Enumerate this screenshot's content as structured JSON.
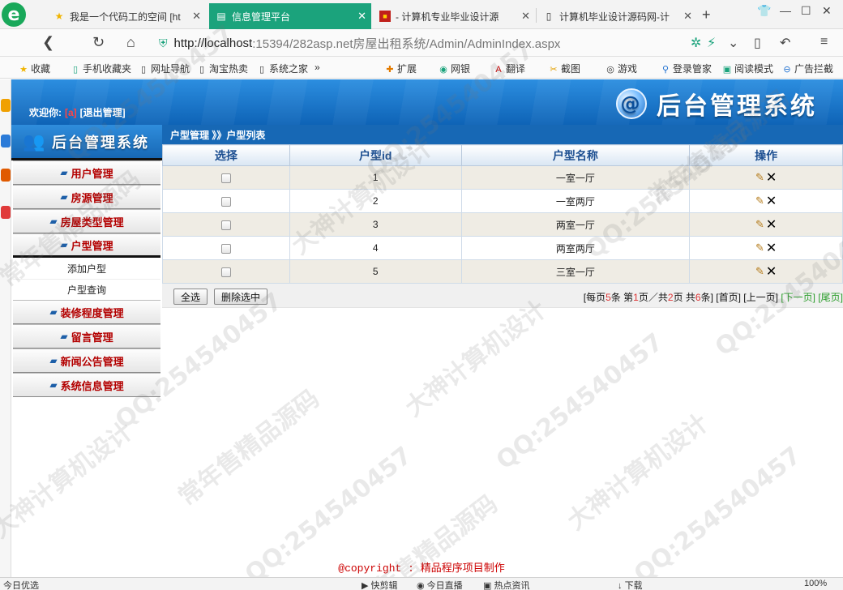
{
  "browser": {
    "tabs": [
      {
        "label": "我是一个代码工的空间 [ht",
        "icon": "star-icon"
      },
      {
        "label": "信息管理平台",
        "icon": "page-icon",
        "active": true
      },
      {
        "label": "- 计算机专业毕业设计源",
        "icon": "site-icon"
      },
      {
        "label": "计算机毕业设计源码网-计",
        "icon": "page-icon"
      }
    ],
    "url_host": "http://localhost",
    "url_path": ":15394/282asp.net房屋出租系统/Admin/AdminIndex.aspx",
    "bookmarks": [
      {
        "label": "收藏",
        "icon": "star-icon"
      },
      {
        "label": "手机收藏夹",
        "icon": "phone-icon"
      },
      {
        "label": "网址导航",
        "icon": "page-icon"
      },
      {
        "label": "淘宝热卖",
        "icon": "page-icon"
      },
      {
        "label": "系统之家",
        "icon": "page-icon"
      },
      {
        "label": "扩展",
        "icon": "puzzle-icon"
      },
      {
        "label": "网银",
        "icon": "bank-icon"
      },
      {
        "label": "翻译",
        "icon": "translate-icon"
      },
      {
        "label": "截图",
        "icon": "scissors-icon"
      },
      {
        "label": "游戏",
        "icon": "game-icon"
      },
      {
        "label": "登录管家",
        "icon": "key-icon"
      },
      {
        "label": "阅读模式",
        "icon": "book-icon"
      },
      {
        "label": "广告拦截",
        "icon": "block-icon"
      }
    ]
  },
  "header": {
    "welcome_prefix": "欢迎你:",
    "username": "[a]",
    "logout": "[退出管理]",
    "title": "后台管理系统"
  },
  "sidebar": {
    "title": "后台管理系统",
    "items": [
      {
        "label": "用户管理"
      },
      {
        "label": "房源管理"
      },
      {
        "label": "房屋类型管理"
      },
      {
        "label": "户型管理"
      },
      {
        "label": "装修程度管理"
      },
      {
        "label": "留言管理"
      },
      {
        "label": "新闻公告管理"
      },
      {
        "label": "系统信息管理"
      }
    ],
    "subitems": [
      "添加户型",
      "户型查询"
    ]
  },
  "content": {
    "breadcrumb": "户型管理 》》户型列表",
    "columns": [
      "选择",
      "户型id",
      "户型名称",
      "操作"
    ],
    "rows": [
      {
        "id": "1",
        "name": "一室一厅"
      },
      {
        "id": "2",
        "name": "一室两厅"
      },
      {
        "id": "3",
        "name": "两室一厅"
      },
      {
        "id": "4",
        "name": "两室两厅"
      },
      {
        "id": "5",
        "name": "三室一厅"
      }
    ],
    "select_all": "全选",
    "delete_selected": "删除选中",
    "pager": {
      "p1": "[每页",
      "per_page": "5",
      "p2": "条 第",
      "current": "1",
      "p3": "页／共",
      "total_pages": "2",
      "p4": "页 共",
      "total": "6",
      "p5": "条]",
      "first": "[首页]",
      "prev": "[上一页]",
      "next": "[下一页]",
      "last": "[尾页]"
    }
  },
  "footer": {
    "copyright": "@copyright : 精品程序项目制作"
  },
  "statusbar": {
    "left": "今日优选",
    "items": [
      "快剪辑",
      "今日直播",
      "热点资讯",
      "下载"
    ],
    "zoom": "100%"
  },
  "watermark": {
    "qq": "QQ:254540457",
    "text_a": "大神计算机设计",
    "text_b": "常年售精品源码"
  },
  "colors": {
    "banner": "#1768b5",
    "active_tab": "#1ba37c",
    "menu_label": "#b30000",
    "row_alt": "#efece4"
  }
}
